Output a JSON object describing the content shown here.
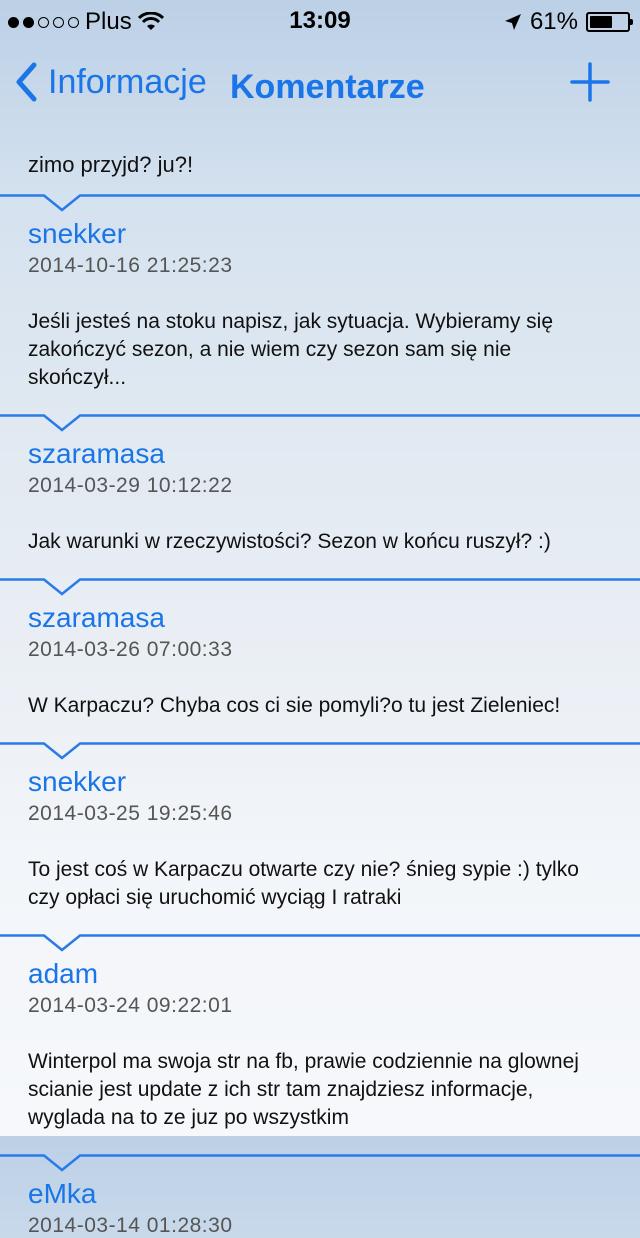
{
  "status_bar": {
    "carrier": "Plus",
    "time": "13:09",
    "battery_percent": "61%",
    "battery_level": 0.61,
    "signal_bars_filled": 2,
    "signal_bars_total": 5
  },
  "navbar": {
    "back_label": "Informacje",
    "title": "Komentarze",
    "accent_color": "#1a75e8"
  },
  "intro_text": "zimo przyjd? ju?!",
  "comments": [
    {
      "author": "snekker",
      "date": "2014-10-16 21:25:23",
      "body": "Jeśli jesteś na stoku napisz, jak sytuacja. Wybieramy się zakończyć sezon, a nie wiem czy sezon sam się nie skończył..."
    },
    {
      "author": "szaramasa",
      "date": "2014-03-29 10:12:22",
      "body": "Jak warunki w rzeczywistości? Sezon w końcu ruszył? :)"
    },
    {
      "author": "szaramasa",
      "date": "2014-03-26 07:00:33",
      "body": "W Karpaczu? Chyba cos ci sie pomyli?o tu jest Zieleniec!"
    },
    {
      "author": "snekker",
      "date": "2014-03-25 19:25:46",
      "body": "To jest coś w Karpaczu otwarte czy nie? śnieg sypie :) tylko czy opłaci się uruchomić wyciąg I ratraki"
    },
    {
      "author": "adam",
      "date": "2014-03-24 09:22:01",
      "body": "Winterpol ma swoja str na fb, prawie codziennie na glownej scianie jest update z ich str tam znajdziesz informacje, wyglada na to ze juz po wszystkim"
    },
    {
      "author": "eMka",
      "date": "2014-03-14 01:28:30",
      "body": ""
    }
  ]
}
